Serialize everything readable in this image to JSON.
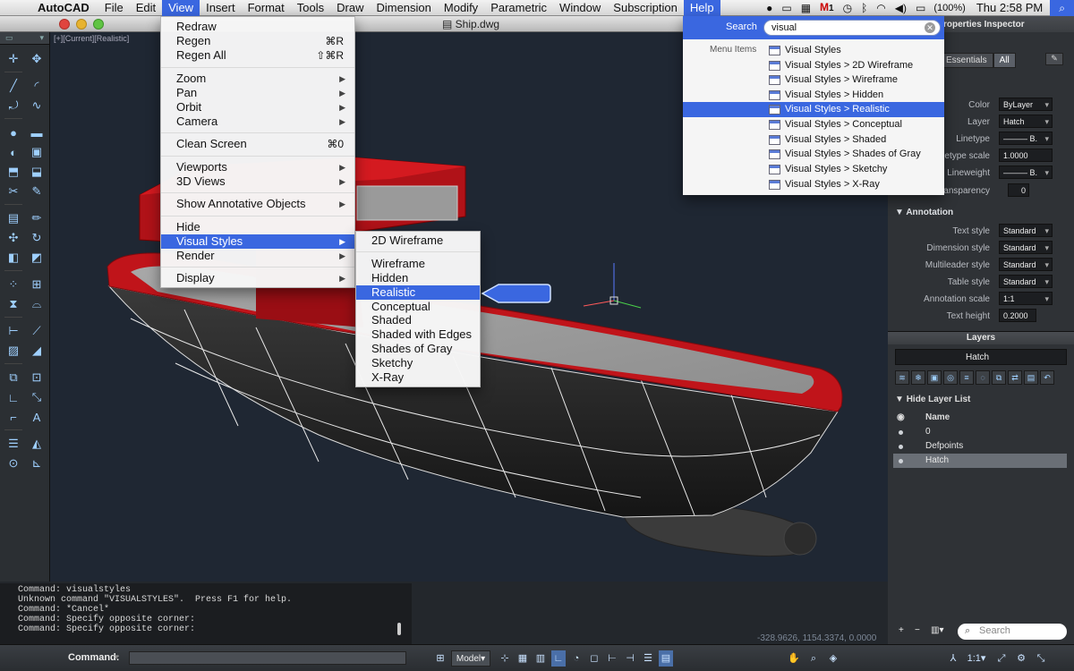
{
  "menubar": {
    "app_name": "AutoCAD",
    "items": [
      "File",
      "Edit",
      "View",
      "Insert",
      "Format",
      "Tools",
      "Draw",
      "Dimension",
      "Modify",
      "Parametric",
      "Window",
      "Subscription",
      "Help"
    ],
    "tray": {
      "battery": "(100%)",
      "clock": "Thu 2:58 PM",
      "mail_count": "1"
    }
  },
  "window": {
    "title": "Ship.dwg",
    "viewport_label": "[+][Current][Realistic]"
  },
  "view_menu": {
    "items": [
      {
        "label": "Redraw",
        "shortcut": ""
      },
      {
        "label": "Regen",
        "shortcut": "⌘R"
      },
      {
        "label": "Regen All",
        "shortcut": "⇧⌘R"
      },
      {
        "label": "Zoom",
        "submenu": true
      },
      {
        "label": "Pan",
        "submenu": true
      },
      {
        "label": "Orbit",
        "submenu": true
      },
      {
        "label": "Camera",
        "submenu": true
      },
      {
        "label": "Clean Screen",
        "shortcut": "⌘0"
      },
      {
        "label": "Viewports",
        "submenu": true
      },
      {
        "label": "3D Views",
        "submenu": true
      },
      {
        "label": "Show Annotative Objects",
        "submenu": true
      },
      {
        "label": "Hide",
        "shortcut": ""
      },
      {
        "label": "Visual Styles",
        "submenu": true,
        "highlighted": true
      },
      {
        "label": "Render",
        "submenu": true
      },
      {
        "label": "Display",
        "submenu": true
      }
    ]
  },
  "visual_styles_submenu": {
    "items": [
      "2D Wireframe",
      "Wireframe",
      "Hidden",
      "Realistic",
      "Conceptual",
      "Shaded",
      "Shaded with Edges",
      "Shades of Gray",
      "Sketchy",
      "X-Ray"
    ],
    "highlighted": "Realistic"
  },
  "help_search": {
    "label": "Search",
    "query": "visual",
    "category": "Menu Items",
    "results": [
      "Visual Styles",
      "Visual Styles > 2D Wireframe",
      "Visual Styles > Wireframe",
      "Visual Styles > Hidden",
      "Visual Styles > Realistic",
      "Visual Styles > Conceptual",
      "Visual Styles > Shaded",
      "Visual Styles > Shades of Gray",
      "Visual Styles > Sketchy",
      "Visual Styles > X-Ray"
    ],
    "highlighted": "Visual Styles > Realistic"
  },
  "properties": {
    "title": "roperties Inspector",
    "tabs": [
      "Essentials",
      "All"
    ],
    "general": [
      {
        "label": "Color",
        "value": "ByLayer"
      },
      {
        "label": "Layer",
        "value": "Hatch"
      },
      {
        "label": "Linetype",
        "value": "——— B."
      },
      {
        "label": "etype scale",
        "value": "1.0000"
      },
      {
        "label": "Lineweight",
        "value": "——— B."
      },
      {
        "label": "ansparency",
        "value": "0"
      }
    ],
    "annotation_title": "Annotation",
    "annotation": [
      {
        "label": "Text style",
        "value": "Standard"
      },
      {
        "label": "Dimension style",
        "value": "Standard"
      },
      {
        "label": "Multileader style",
        "value": "Standard"
      },
      {
        "label": "Table style",
        "value": "Standard"
      },
      {
        "label": "Annotation scale",
        "value": "1:1"
      },
      {
        "label": "Text height",
        "value": "0.2000"
      }
    ]
  },
  "layers": {
    "title": "Layers",
    "current": "Hatch",
    "hide_label": "Hide Layer List",
    "header": "Name",
    "rows": [
      "0",
      "Defpoints",
      "Hatch"
    ],
    "selected": "Hatch",
    "search_placeholder": "Search"
  },
  "command": {
    "history": [
      "Command: visualstyles",
      "Unknown command \"VISUALSTYLES\".  Press F1 for help.",
      "Command: *Cancel*",
      "Command: Specify opposite corner:",
      "Command: Specify opposite corner:"
    ],
    "label": "Command:",
    "coords": "-328.9626, 1154.3374, 0.0000"
  },
  "statusbar": {
    "model": "Model",
    "scale": "1:1"
  },
  "colors": {
    "accent": "#3a67e0",
    "hull_red": "#c0141a",
    "viewport_bg": "#1f2733"
  }
}
